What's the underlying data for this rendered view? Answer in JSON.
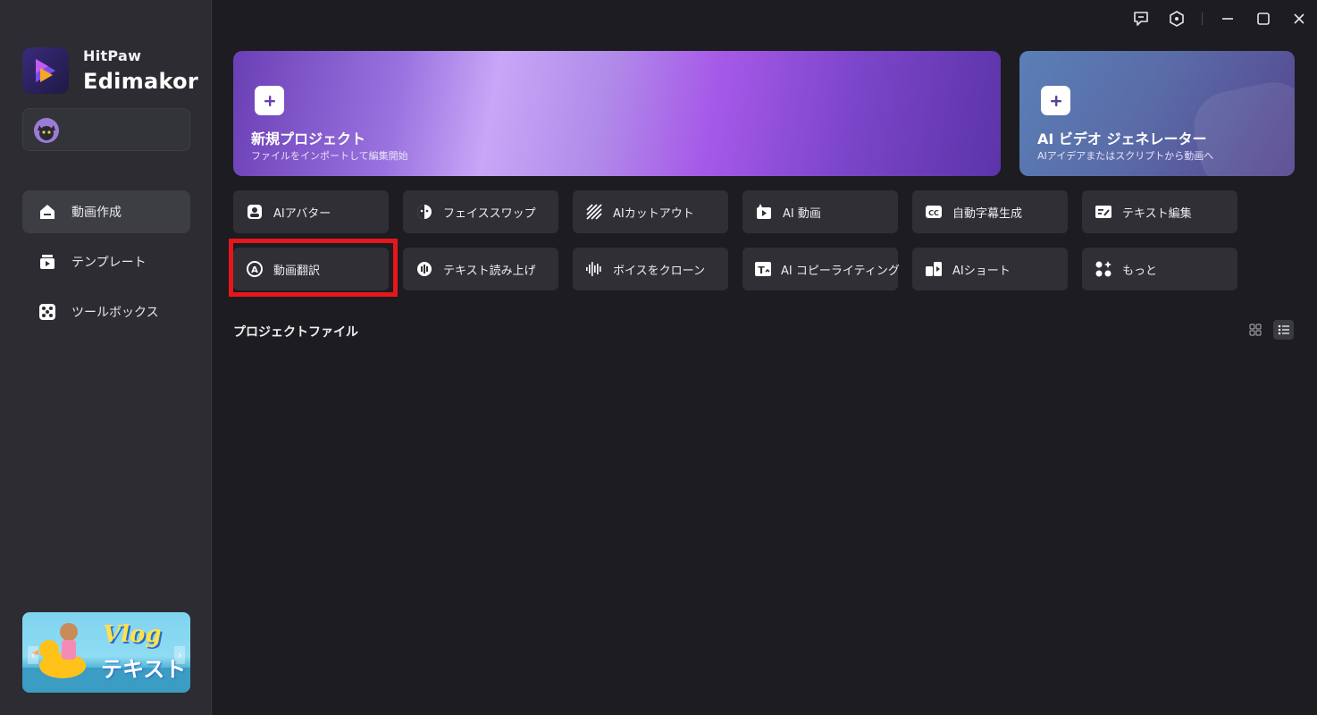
{
  "app": {
    "brand_top": "HitPaw",
    "brand_main": "Edimakor"
  },
  "sidebar": {
    "items": [
      {
        "label": "動画作成",
        "icon": "home-icon",
        "active": true
      },
      {
        "label": "テンプレート",
        "icon": "template-icon",
        "active": false
      },
      {
        "label": "ツールボックス",
        "icon": "toolbox-icon",
        "active": false
      }
    ],
    "promo": {
      "title": "Vlog",
      "subtitle": "テキスト"
    }
  },
  "hero": {
    "new_project": {
      "title": "新規プロジェクト",
      "subtitle": "ファイルをインポートして編集開始"
    },
    "ai_video": {
      "title": "AI ビデオ ジェネレーター",
      "subtitle": "AIアイデアまたはスクリプトから動画へ"
    }
  },
  "tools": [
    {
      "label": "AIアバター",
      "icon": "avatar-icon"
    },
    {
      "label": "フェイススワップ",
      "icon": "face-swap-icon"
    },
    {
      "label": "AIカットアウト",
      "icon": "cutout-icon"
    },
    {
      "label": "AI 動画",
      "icon": "ai-video-icon"
    },
    {
      "label": "自動字幕生成",
      "icon": "cc-icon"
    },
    {
      "label": "テキスト編集",
      "icon": "text-edit-icon"
    },
    {
      "label": "動画翻訳",
      "icon": "translate-icon"
    },
    {
      "label": "テキスト読み上げ",
      "icon": "tts-icon"
    },
    {
      "label": "ボイスをクローン",
      "icon": "voice-clone-icon"
    },
    {
      "label": "AI コピーライティング",
      "icon": "copywriting-icon"
    },
    {
      "label": "AIショート",
      "icon": "ai-shorts-icon"
    },
    {
      "label": "もっと",
      "icon": "more-icon"
    }
  ],
  "projects": {
    "section_title": "プロジェクトファイル",
    "view_mode": "list"
  },
  "colors": {
    "highlight": "#e8161b",
    "background": "#1c1c21",
    "sidebar": "#2c2c32"
  }
}
